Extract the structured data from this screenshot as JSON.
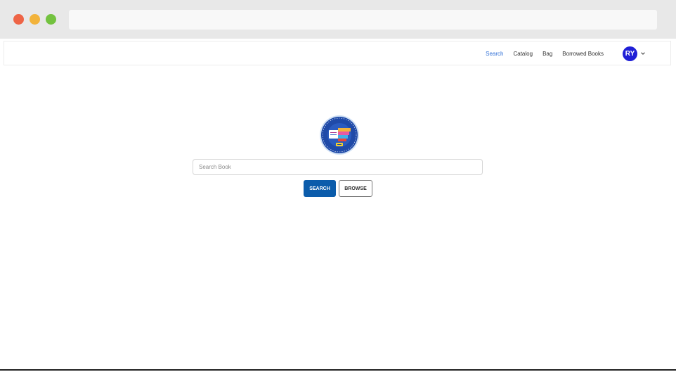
{
  "nav": {
    "links": [
      {
        "label": "Search",
        "active": true
      },
      {
        "label": "Catalog",
        "active": false
      },
      {
        "label": "Bag",
        "active": false
      },
      {
        "label": "Borrowed Books",
        "active": false
      }
    ],
    "avatar_initials": "RY"
  },
  "search": {
    "placeholder": "Search Book",
    "value": ""
  },
  "buttons": {
    "search_label": "SEARCH",
    "browse_label": "BROWSE"
  },
  "colors": {
    "accent": "#0b5cab",
    "nav_active": "#2f6fd6",
    "avatar": "#1f1fd6",
    "logo_ring": "#1f4aa8"
  }
}
